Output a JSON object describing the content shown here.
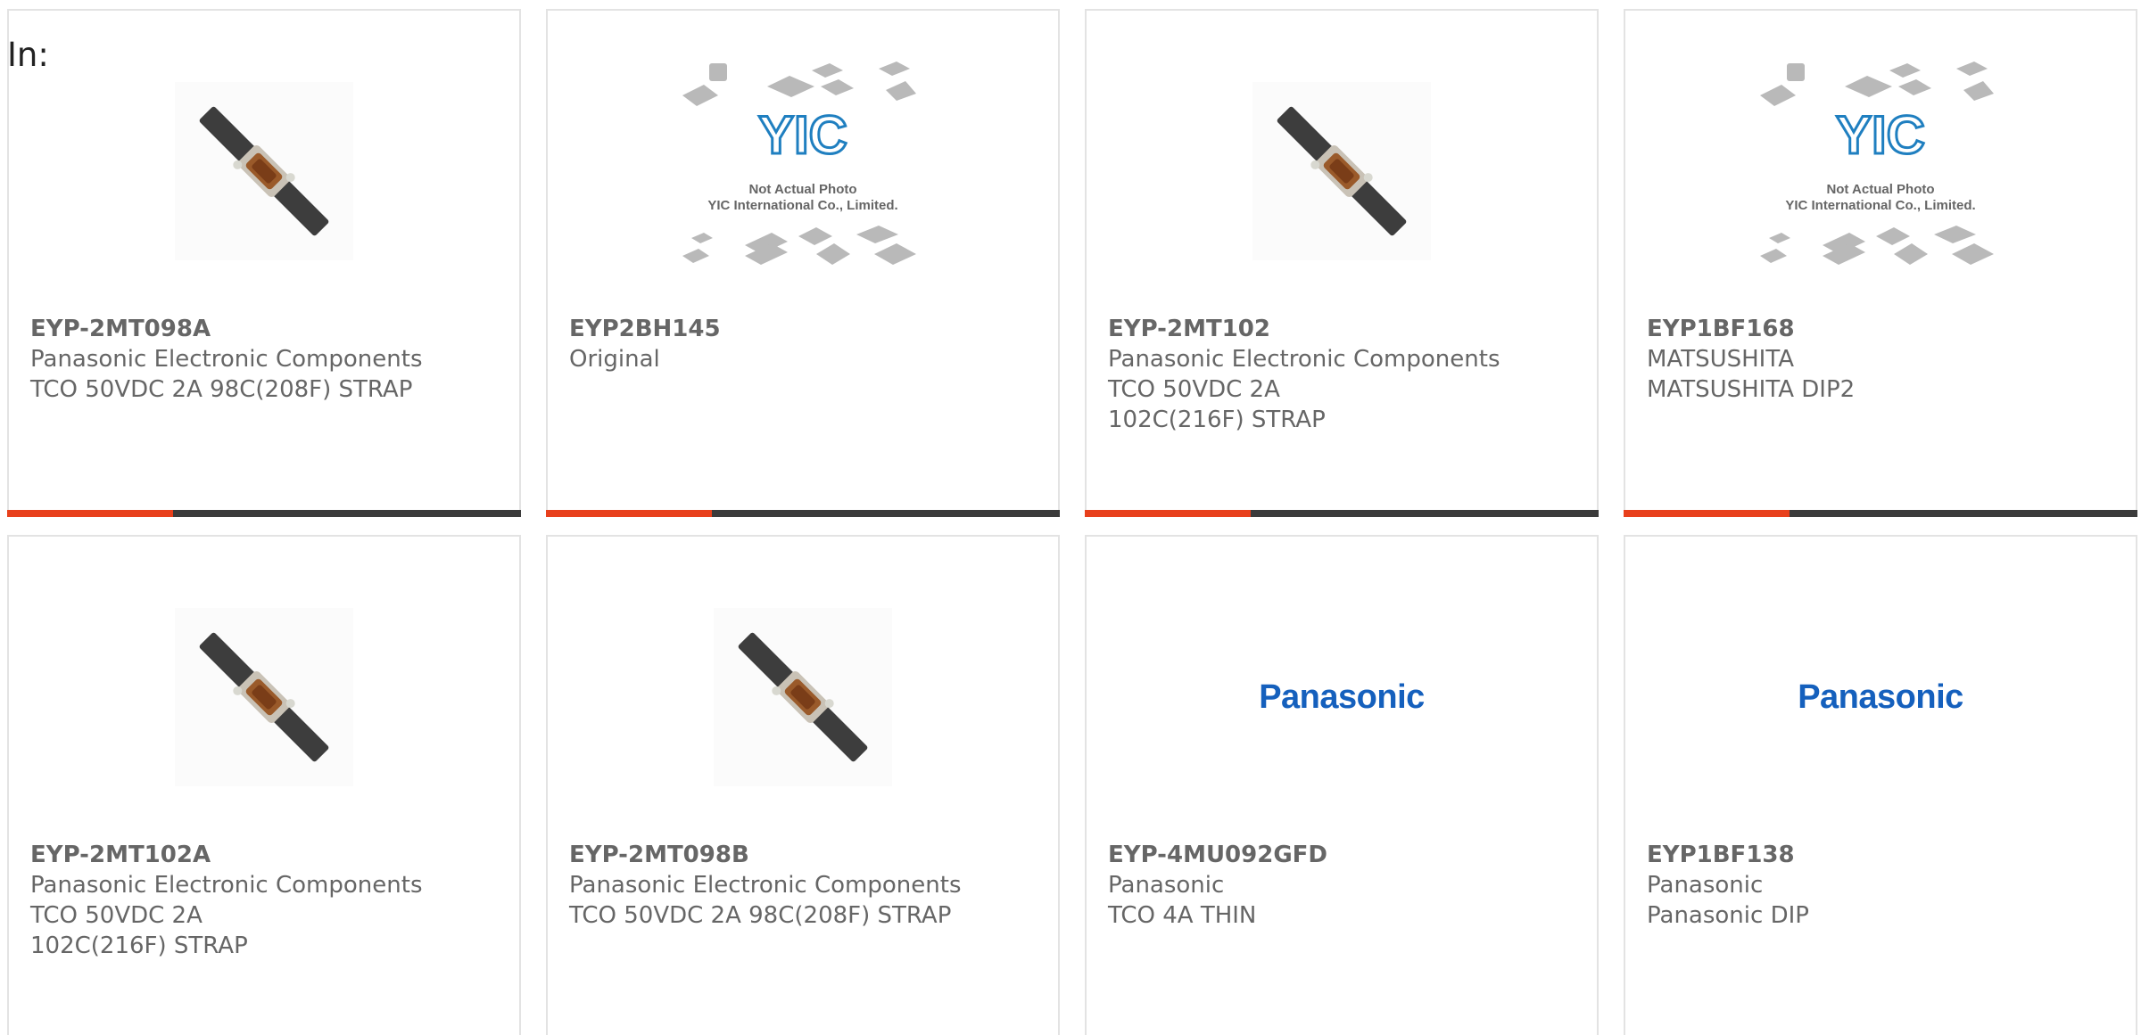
{
  "filter": {
    "label": "In:"
  },
  "colors": {
    "accent": "#e8401c",
    "bar_dark": "#3b3b3b",
    "brand_blue": "#1560bd"
  },
  "products": [
    {
      "part": "EYP-2MT098A",
      "maker": "Panasonic Electronic Components",
      "desc": "TCO 50VDC 2A 98C(208F) STRAP",
      "image": "fuse-strap-icon"
    },
    {
      "part": "EYP2BH145",
      "maker": "Original",
      "desc": "",
      "image": "placeholder-photo",
      "placeholder_line1": "Not Actual Photo",
      "placeholder_line2": "YIC International Co., Limited.",
      "placeholder_logo": "YIC"
    },
    {
      "part": "EYP-2MT102",
      "maker": "Panasonic Electronic Components",
      "desc": "TCO 50VDC 2A 102C(216F) STRAP",
      "image": "fuse-strap-icon"
    },
    {
      "part": "EYP1BF168",
      "maker": "MATSUSHITA",
      "desc": "MATSUSHITA DIP2",
      "image": "placeholder-photo",
      "placeholder_line1": "Not Actual Photo",
      "placeholder_line2": "YIC International Co., Limited.",
      "placeholder_logo": "YIC"
    },
    {
      "part": "EYP-2MT102A",
      "maker": "Panasonic Electronic Components",
      "desc": "TCO 50VDC 2A 102C(216F) STRAP",
      "image": "fuse-strap-icon"
    },
    {
      "part": "EYP-2MT098B",
      "maker": "Panasonic Electronic Components",
      "desc": "TCO 50VDC 2A 98C(208F) STRAP",
      "image": "fuse-strap-icon"
    },
    {
      "part": "EYP-4MU092GFD",
      "maker": "Panasonic",
      "desc": "TCO 4A THIN",
      "image": "panasonic-logo",
      "logo_text": "Panasonic"
    },
    {
      "part": "EYP1BF138",
      "maker": "Panasonic",
      "desc": "Panasonic DIP",
      "image": "panasonic-logo",
      "logo_text": "Panasonic"
    }
  ]
}
